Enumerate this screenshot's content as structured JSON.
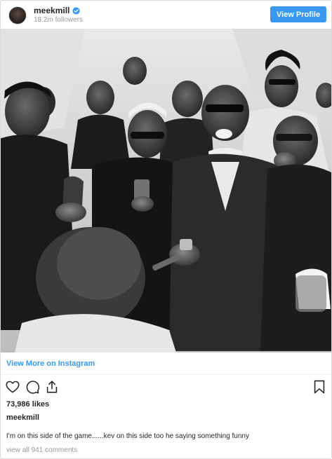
{
  "header": {
    "username": "meekmill",
    "followers": "18.2m followers",
    "view_profile_label": "View Profile",
    "verified_icon": "verified-badge-icon",
    "avatar": "profile-avatar"
  },
  "photo": {
    "style": "black-and-white group photo"
  },
  "post": {
    "view_more_label": "View More on Instagram",
    "likes": "73,986 likes",
    "caption_user": "meekmill",
    "caption_text": "I'm on this side of the game......kev on this side too he saying something funny",
    "view_comments": "view all 941 comments"
  },
  "icons": {
    "like": "heart-icon",
    "comment": "comment-icon",
    "share": "share-icon",
    "save": "bookmark-icon"
  },
  "colors": {
    "accent": "#3897f0",
    "text": "#262626",
    "muted": "#999999",
    "border": "#dbdbdb"
  }
}
